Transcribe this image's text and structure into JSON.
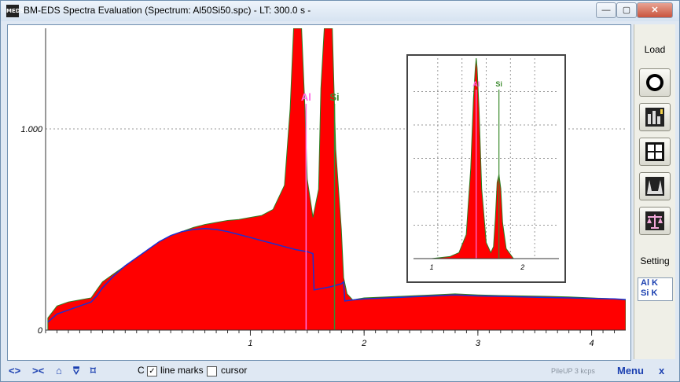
{
  "window": {
    "icon_text": "MEDS",
    "title": "BM-EDS Spectra Evaluation (Spectrum: Al50Si50.spc) - LT: 300.0 s -",
    "controls": {
      "minimize": "—",
      "restore": "▢",
      "close": "✕"
    }
  },
  "chart_data": {
    "type": "area",
    "xlim": [
      -0.8,
      4.3
    ],
    "ylim": [
      0,
      1500
    ],
    "xticks": [
      "1",
      "2",
      "3",
      "4"
    ],
    "xtick_values": [
      1,
      2,
      3,
      4
    ],
    "yticks": [
      "0",
      "1.000"
    ],
    "ytick_values": [
      0,
      1000
    ],
    "grid": true,
    "series": [
      {
        "name": "spectrum",
        "color": "#ff0000",
        "x": [
          -0.78,
          -0.7,
          -0.6,
          -0.5,
          -0.4,
          -0.35,
          -0.3,
          -0.2,
          -0.1,
          0.0,
          0.1,
          0.2,
          0.3,
          0.4,
          0.5,
          0.6,
          0.7,
          0.8,
          0.9,
          1.0,
          1.1,
          1.2,
          1.3,
          1.35,
          1.38,
          1.4,
          1.42,
          1.45,
          1.48,
          1.5,
          1.55,
          1.6,
          1.62,
          1.65,
          1.68,
          1.7,
          1.72,
          1.75,
          1.8,
          1.82,
          1.85,
          1.9,
          1.95,
          2.0,
          2.2,
          2.4,
          2.6,
          2.8,
          3.0,
          3.2,
          3.4,
          3.6,
          3.8,
          4.0,
          4.2,
          4.3
        ],
        "y": [
          60,
          120,
          140,
          150,
          160,
          200,
          240,
          280,
          320,
          360,
          400,
          440,
          470,
          490,
          510,
          525,
          535,
          545,
          550,
          560,
          570,
          600,
          720,
          1100,
          1500,
          1500,
          1500,
          1500,
          1100,
          750,
          560,
          700,
          1200,
          1500,
          1500,
          1500,
          1500,
          900,
          500,
          260,
          180,
          150,
          155,
          160,
          165,
          170,
          175,
          180,
          175,
          172,
          170,
          168,
          165,
          160,
          155,
          150
        ]
      },
      {
        "name": "background",
        "color": "#1e2fd0",
        "x": [
          -0.78,
          -0.7,
          -0.6,
          -0.5,
          -0.4,
          -0.35,
          -0.3,
          -0.2,
          -0.1,
          0.0,
          0.1,
          0.2,
          0.3,
          0.4,
          0.5,
          0.6,
          0.7,
          0.8,
          0.9,
          1.0,
          1.1,
          1.2,
          1.3,
          1.4,
          1.5,
          1.55,
          1.56,
          1.7,
          1.8,
          1.82,
          1.83,
          1.9,
          2.0,
          2.2,
          2.4,
          2.6,
          2.8,
          3.0,
          3.2,
          3.4,
          3.6,
          3.8,
          4.0,
          4.2,
          4.3
        ],
        "y": [
          40,
          80,
          100,
          120,
          140,
          170,
          210,
          270,
          320,
          360,
          400,
          440,
          470,
          490,
          500,
          505,
          500,
          490,
          475,
          460,
          445,
          430,
          415,
          400,
          390,
          380,
          200,
          215,
          230,
          240,
          145,
          150,
          155,
          160,
          165,
          170,
          175,
          170,
          168,
          165,
          162,
          160,
          158,
          155,
          152
        ]
      }
    ],
    "peaks": [
      {
        "label": "Al",
        "x": 1.49,
        "color": "#ff6ee6"
      },
      {
        "label": "Si",
        "x": 1.74,
        "color": "#3c8a2e"
      }
    ],
    "inset": {
      "type": "area",
      "xlim": [
        0.8,
        2.4
      ],
      "ylim": [
        0,
        1
      ],
      "xticks": [
        "1",
        "2"
      ],
      "xtick_values": [
        1,
        2
      ],
      "grid": true,
      "series": [
        {
          "name": "spectrum",
          "color": "#ff0000",
          "x": [
            0.8,
            1.0,
            1.2,
            1.3,
            1.38,
            1.43,
            1.46,
            1.48,
            1.49,
            1.5,
            1.52,
            1.55,
            1.6,
            1.65,
            1.68,
            1.7,
            1.72,
            1.74,
            1.76,
            1.78,
            1.82,
            1.9,
            2.0,
            2.2,
            2.4
          ],
          "y": [
            0.0,
            0.0,
            0.01,
            0.03,
            0.12,
            0.45,
            0.8,
            0.95,
            1.0,
            0.95,
            0.75,
            0.35,
            0.08,
            0.03,
            0.06,
            0.2,
            0.38,
            0.42,
            0.35,
            0.18,
            0.05,
            0.0,
            0.0,
            0.0,
            0.0
          ]
        }
      ],
      "peaks": [
        {
          "label": "Al",
          "x": 1.49,
          "color": "#ff6ee6"
        },
        {
          "label": "Si",
          "x": 1.74,
          "color": "#3c8a2e"
        }
      ]
    }
  },
  "sidepanel": {
    "load_label": "Load",
    "setting_label": "Setting",
    "buttons": [
      "circle-icon",
      "bar-settings-icon",
      "quad-layout-icon",
      "peak-shape-icon",
      "balance-icon"
    ],
    "elements": [
      "Al K",
      "Si K"
    ]
  },
  "bottombar": {
    "nav_glyphs": [
      "<>",
      "><",
      "⌂",
      "⩢",
      "⌑"
    ],
    "c_label": "C",
    "line_marks_label": "line marks",
    "line_marks_checked": true,
    "cursor_label": "cursor",
    "cursor_checked": false,
    "pileup_text": "PileUP 3 kcps",
    "menu_label": "Menu",
    "close_label": "x"
  }
}
